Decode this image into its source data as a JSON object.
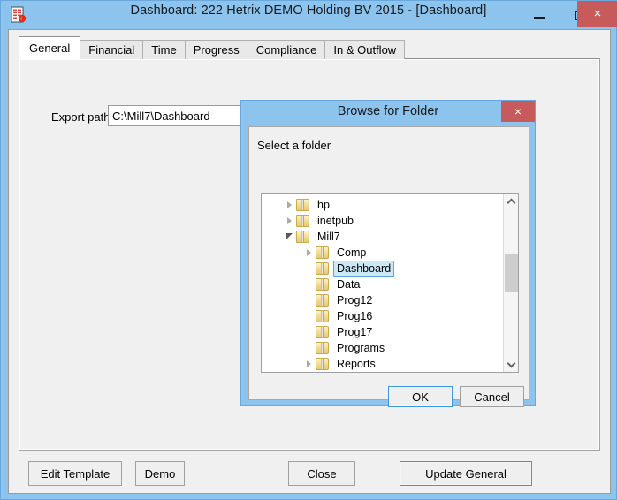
{
  "window": {
    "title": "Dashboard: 222 Hetrix DEMO Holding BV 2015 - [Dashboard]",
    "icon": "report-document-icon",
    "controls": {
      "minimize": "–",
      "maximize": "□",
      "close": "×"
    },
    "colors": {
      "titlebar": "#8cc4ee",
      "close_button": "#c75b5b",
      "focus_border": "#3c97e0",
      "selection": "#cce8f7"
    }
  },
  "tabs": [
    {
      "label": "General",
      "active": true
    },
    {
      "label": "Financial",
      "active": false
    },
    {
      "label": "Time",
      "active": false
    },
    {
      "label": "Progress",
      "active": false
    },
    {
      "label": "Compliance",
      "active": false
    },
    {
      "label": "In & Outflow",
      "active": false
    }
  ],
  "general_tab": {
    "export_path": {
      "label": "Export path",
      "value": "C:\\Mill7\\Dashboard",
      "placeholder": "",
      "browse_button_label": "..."
    }
  },
  "footer": {
    "edit_template": "Edit Template",
    "demo": "Demo",
    "close": "Close",
    "update_general": "Update General"
  },
  "browse_dialog": {
    "title": "Browse for Folder",
    "close_label": "×",
    "prompt": "Select a folder",
    "tree": [
      {
        "label": "hp",
        "indent": 1,
        "expander": "collapsed",
        "selected": false
      },
      {
        "label": "inetpub",
        "indent": 1,
        "expander": "collapsed",
        "selected": false
      },
      {
        "label": "Mill7",
        "indent": 1,
        "expander": "expanded",
        "selected": false
      },
      {
        "label": "Comp",
        "indent": 2,
        "expander": "collapsed",
        "selected": false
      },
      {
        "label": "Dashboard",
        "indent": 2,
        "expander": "none",
        "selected": true
      },
      {
        "label": "Data",
        "indent": 2,
        "expander": "none",
        "selected": false
      },
      {
        "label": "Prog12",
        "indent": 2,
        "expander": "none",
        "selected": false
      },
      {
        "label": "Prog16",
        "indent": 2,
        "expander": "none",
        "selected": false
      },
      {
        "label": "Prog17",
        "indent": 2,
        "expander": "none",
        "selected": false
      },
      {
        "label": "Programs",
        "indent": 2,
        "expander": "none",
        "selected": false
      },
      {
        "label": "Reports",
        "indent": 2,
        "expander": "collapsed",
        "selected": false
      }
    ],
    "scrollbar": {
      "up_icon": "chevron-up-icon",
      "down_icon": "chevron-down-icon"
    },
    "buttons": {
      "ok": "OK",
      "cancel": "Cancel"
    }
  }
}
